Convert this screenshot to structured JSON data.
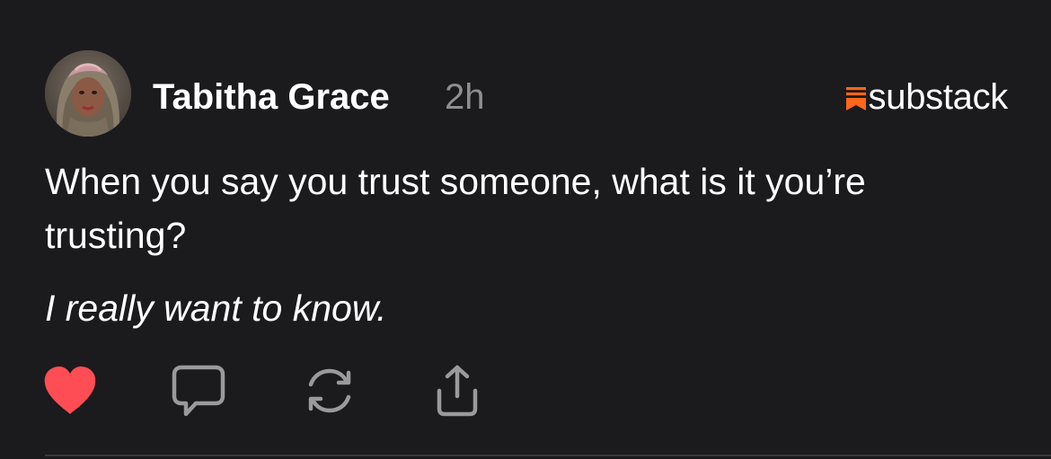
{
  "post": {
    "author": {
      "name": "Tabitha Grace",
      "avatar_icon": "avatar-photo"
    },
    "time": "2h",
    "brand": {
      "name": "substack",
      "icon": "substack-logo-icon",
      "accent_color": "#ff6719"
    },
    "body": "When you say you trust someone, what is it you’re trusting?",
    "emphasis": "I really want to know.",
    "actions": {
      "like_icon": "heart-icon",
      "like_color": "#ff4d55",
      "liked": true,
      "comment_icon": "comment-bubble-icon",
      "restack_icon": "restack-icon",
      "share_icon": "share-icon"
    },
    "colors": {
      "background": "#1b1a1d",
      "muted_text": "#8e8e93",
      "icon_gray": "#9a9a9e"
    }
  }
}
